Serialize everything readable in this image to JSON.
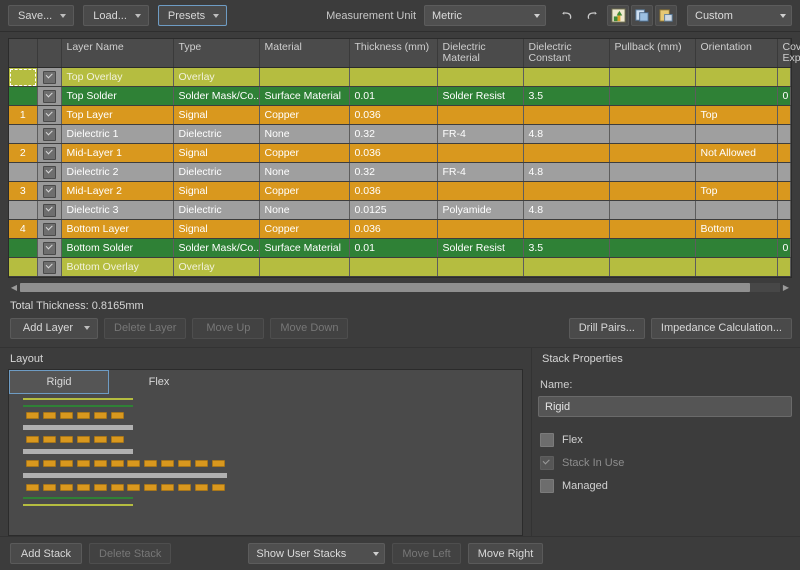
{
  "toolbar": {
    "save_label": "Save...",
    "load_label": "Load...",
    "presets_label": "Presets",
    "measurement_unit_label": "Measurement Unit",
    "measurement_unit_value": "Metric",
    "undo_icon": "undo-icon",
    "redo_icon": "redo-icon",
    "icon1": "layers-color-icon",
    "icon2": "copy-layers-icon",
    "icon3": "paste-layers-icon",
    "preset_select_value": "Custom"
  },
  "table": {
    "columns": [
      "",
      "",
      "Layer Name",
      "Type",
      "Material",
      "Thickness (mm)",
      "Dielectric Material",
      "Dielectric Constant",
      "Pullback (mm)",
      "Orientation",
      "Coverlay Expansion"
    ],
    "rows": [
      {
        "index": "",
        "enabled": true,
        "kind": "overlay",
        "selected": true,
        "name": "Top Overlay",
        "type": "Overlay",
        "material": "",
        "thickness": "",
        "dielectric_material": "",
        "dielectric_constant": "",
        "pullback": "",
        "orientation": "",
        "coverlay_expansion": ""
      },
      {
        "index": "",
        "enabled": true,
        "kind": "solder",
        "selected": false,
        "name": "Top Solder",
        "type": "Solder Mask/Co...",
        "material": "Surface Material",
        "thickness": "0.01",
        "dielectric_material": "Solder Resist",
        "dielectric_constant": "3.5",
        "pullback": "",
        "orientation": "",
        "coverlay_expansion": "0"
      },
      {
        "index": "1",
        "enabled": true,
        "kind": "signal",
        "selected": false,
        "name": "Top Layer",
        "type": "Signal",
        "material": "Copper",
        "thickness": "0.036",
        "dielectric_material": "",
        "dielectric_constant": "",
        "pullback": "",
        "orientation": "Top",
        "coverlay_expansion": ""
      },
      {
        "index": "",
        "enabled": true,
        "kind": "diel",
        "selected": false,
        "name": "Dielectric 1",
        "type": "Dielectric",
        "material": "None",
        "thickness": "0.32",
        "dielectric_material": "FR-4",
        "dielectric_constant": "4.8",
        "pullback": "",
        "orientation": "",
        "coverlay_expansion": ""
      },
      {
        "index": "2",
        "enabled": true,
        "kind": "signal",
        "selected": false,
        "name": "Mid-Layer 1",
        "type": "Signal",
        "material": "Copper",
        "thickness": "0.036",
        "dielectric_material": "",
        "dielectric_constant": "",
        "pullback": "",
        "orientation": "Not Allowed",
        "coverlay_expansion": ""
      },
      {
        "index": "",
        "enabled": true,
        "kind": "diel",
        "selected": false,
        "name": "Dielectric 2",
        "type": "Dielectric",
        "material": "None",
        "thickness": "0.32",
        "dielectric_material": "FR-4",
        "dielectric_constant": "4.8",
        "pullback": "",
        "orientation": "",
        "coverlay_expansion": ""
      },
      {
        "index": "3",
        "enabled": true,
        "kind": "signal",
        "selected": false,
        "name": "Mid-Layer 2",
        "type": "Signal",
        "material": "Copper",
        "thickness": "0.036",
        "dielectric_material": "",
        "dielectric_constant": "",
        "pullback": "",
        "orientation": "Top",
        "coverlay_expansion": ""
      },
      {
        "index": "",
        "enabled": true,
        "kind": "diel",
        "selected": false,
        "name": "Dielectric 3",
        "type": "Dielectric",
        "material": "None",
        "thickness": "0.0125",
        "dielectric_material": "Polyamide",
        "dielectric_constant": "4.8",
        "pullback": "",
        "orientation": "",
        "coverlay_expansion": ""
      },
      {
        "index": "4",
        "enabled": true,
        "kind": "signal",
        "selected": false,
        "name": "Bottom Layer",
        "type": "Signal",
        "material": "Copper",
        "thickness": "0.036",
        "dielectric_material": "",
        "dielectric_constant": "",
        "pullback": "",
        "orientation": "Bottom",
        "coverlay_expansion": ""
      },
      {
        "index": "",
        "enabled": true,
        "kind": "solder",
        "selected": false,
        "name": "Bottom Solder",
        "type": "Solder Mask/Co...",
        "material": "Surface Material",
        "thickness": "0.01",
        "dielectric_material": "Solder Resist",
        "dielectric_constant": "3.5",
        "pullback": "",
        "orientation": "",
        "coverlay_expansion": "0"
      },
      {
        "index": "",
        "enabled": true,
        "kind": "overlay",
        "selected": false,
        "name": "Bottom Overlay",
        "type": "Overlay",
        "material": "",
        "thickness": "",
        "dielectric_material": "",
        "dielectric_constant": "",
        "pullback": "",
        "orientation": "",
        "coverlay_expansion": ""
      }
    ]
  },
  "summary": {
    "total_thickness": "Total Thickness: 0.8165mm",
    "add_layer": "Add Layer",
    "delete_layer": "Delete Layer",
    "move_up": "Move Up",
    "move_down": "Move Down",
    "drill_pairs": "Drill Pairs...",
    "impedance_calculation": "Impedance Calculation..."
  },
  "layout": {
    "title": "Layout",
    "tabs": [
      {
        "label": "Rigid",
        "active": true
      },
      {
        "label": "Flex",
        "active": false
      }
    ],
    "colors": {
      "overlay": "#b5bd40",
      "solder": "#2f8136",
      "signal": "#d9981e",
      "dielectric": "#b0b0b0",
      "canvas": "#4a4a4a"
    }
  },
  "stack_properties": {
    "title": "Stack Properties",
    "name_label": "Name:",
    "name_value": "Rigid",
    "options": [
      {
        "label": "Flex",
        "checked": false,
        "enabled": true
      },
      {
        "label": "Stack In Use",
        "checked": true,
        "enabled": false
      },
      {
        "label": "Managed",
        "checked": false,
        "enabled": true
      }
    ]
  },
  "footer": {
    "add_stack": "Add Stack",
    "delete_stack": "Delete Stack",
    "show_filter_value": "Show User Stacks",
    "move_left": "Move Left",
    "move_right": "Move Right"
  }
}
